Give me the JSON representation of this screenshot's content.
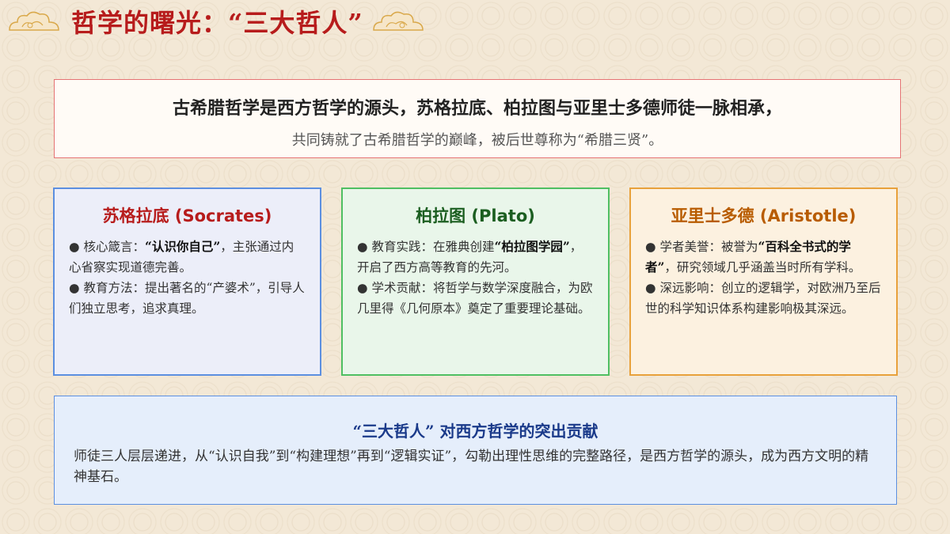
{
  "header": {
    "title": "哲学的曙光：“三大哲人”"
  },
  "intro": {
    "line1": "古希腊哲学是西方哲学的源头，苏格拉底、柏拉图与亚里士多德师徒一脉相承，",
    "line2": "共同铸就了古希腊哲学的巅峰，被后世尊称为“希腊三贤”。"
  },
  "cards": [
    {
      "title": "苏格拉底 (Socrates)",
      "bullets": [
        {
          "pre": "● 核心箴言：",
          "bold": "“认识你自己”",
          "post": "，主张通过内心省察实现道德完善。"
        },
        {
          "pre": "● 教育方法：提出著名的“产婆术”，引导人们独立思考，追求真理。",
          "bold": "",
          "post": ""
        }
      ]
    },
    {
      "title": "柏拉图 (Plato)",
      "bullets": [
        {
          "pre": "● 教育实践：在雅典创建",
          "bold": "“柏拉图学园”",
          "post": "，开启了西方高等教育的先河。"
        },
        {
          "pre": "● 学术贡献：将哲学与数学深度融合，为欧几里得《几何原本》奠定了重要理论基础。",
          "bold": "",
          "post": ""
        }
      ]
    },
    {
      "title": "亚里士多德 (Aristotle)",
      "bullets": [
        {
          "pre": "● 学者美誉：被誉为",
          "bold": "“百科全书式的学者”",
          "post": "，研究领域几乎涵盖当时所有学科。"
        },
        {
          "pre": "● 深远影响：创立的逻辑学，对欧洲乃至后世的科学知识体系构建影响极其深远。",
          "bold": "",
          "post": ""
        }
      ]
    }
  ],
  "summary": {
    "title": "“三大哲人” 对西方哲学的突出贡献",
    "text": "师徒三人层层递进，从“认识自我”到“构建理想”再到“逻辑实证”，勾勒出理性思维的完整路径，是西方哲学的源头，成为西方文明的精神基石。"
  },
  "colors": {
    "title_red": "#b71c1c",
    "blue_border": "#5c8fe0",
    "green_border": "#4fbf62",
    "orange_border": "#e8a13b"
  }
}
